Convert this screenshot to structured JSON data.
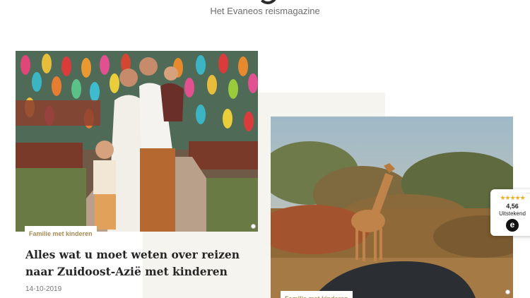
{
  "header": {
    "tagline": "Het Evaneos reismagazine"
  },
  "cards": [
    {
      "category": "Familie met kinderen",
      "title": "Alles wat u moet weten over reizen naar Zuidoost-Azië met kinderen",
      "date": "14-10-2019",
      "image": "family-travel-photo"
    },
    {
      "category": "Familie met kinderen",
      "image": "giraffe-safari-photo"
    }
  ],
  "trust_widget": {
    "stars": "★★★★★",
    "score": "4,56",
    "label": "Uitstekend",
    "menu": "..."
  }
}
